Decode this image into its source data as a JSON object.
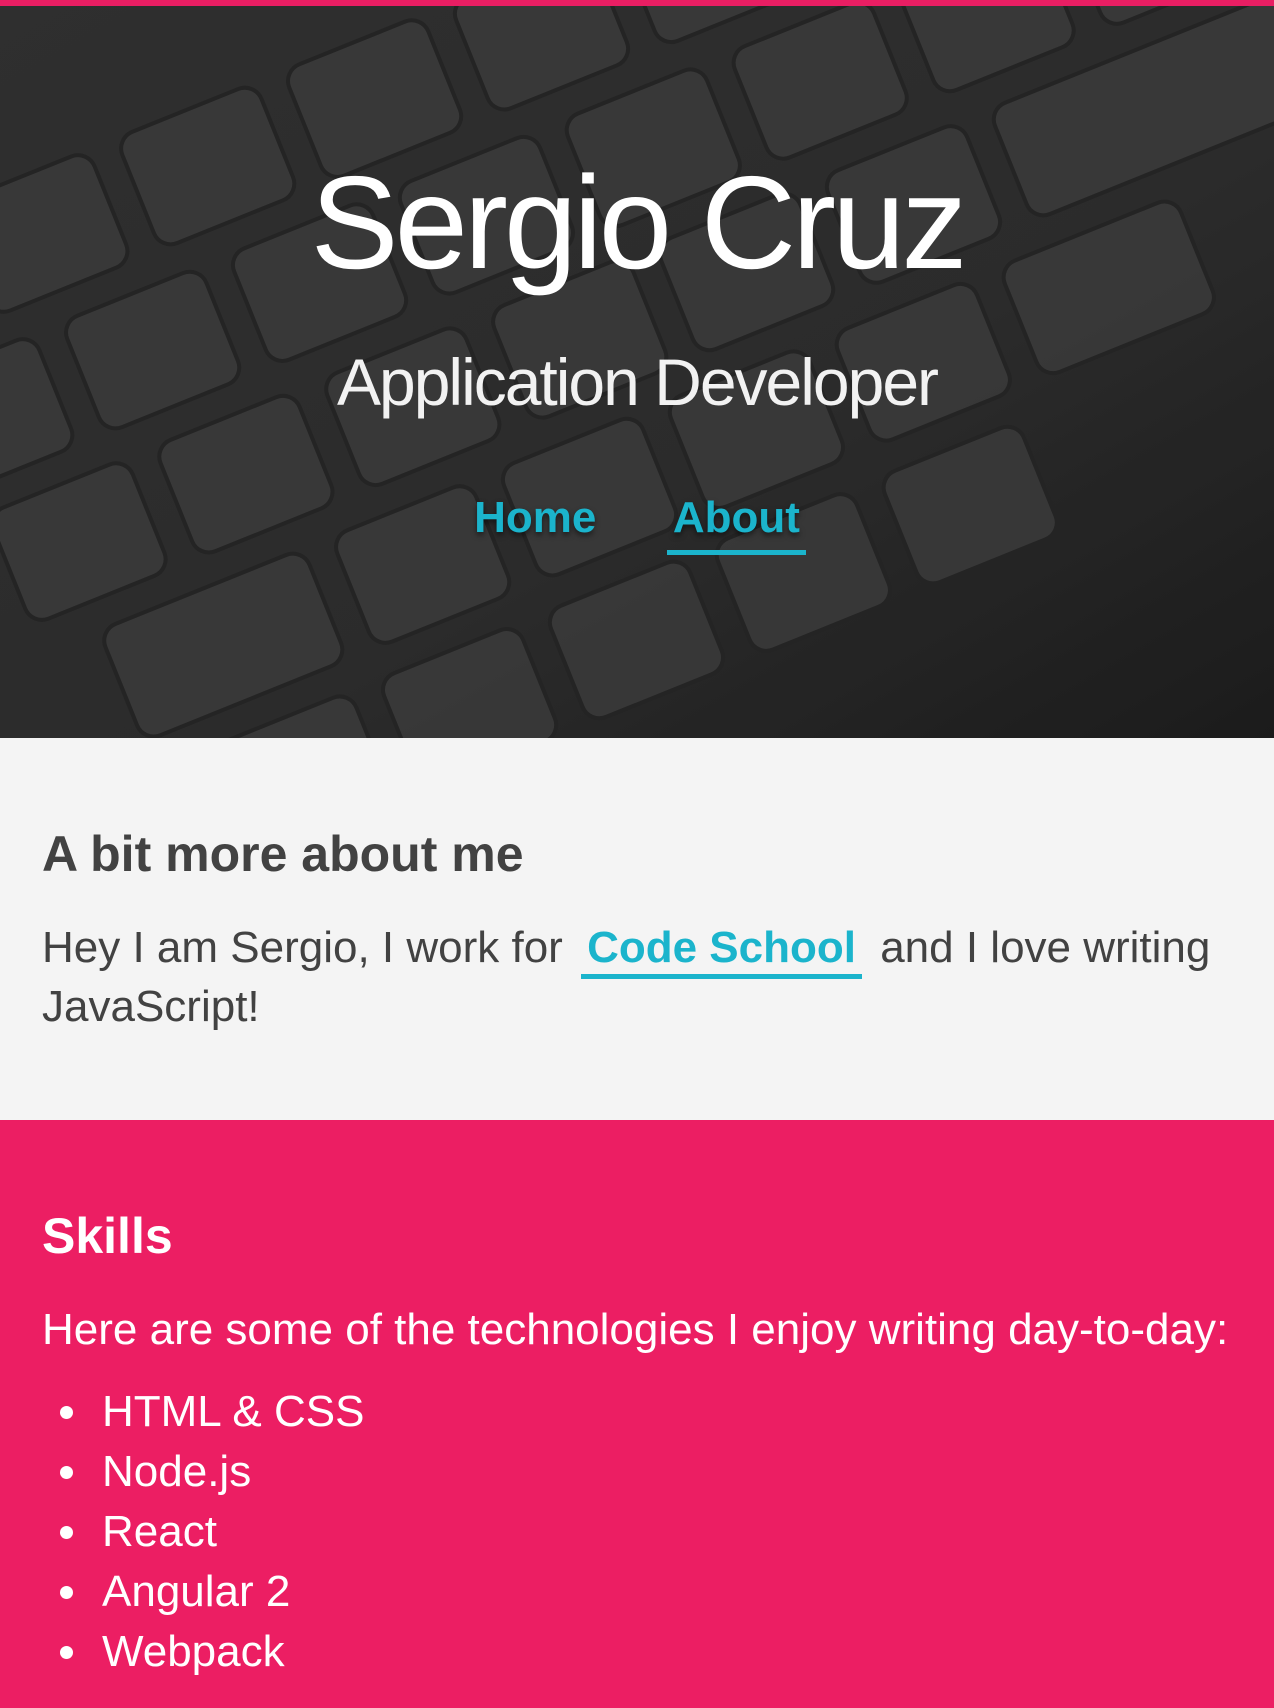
{
  "colors": {
    "accent": "#e91e63",
    "link": "#1bb4cc",
    "hero_overlay": "#3a3a3a",
    "about_bg": "#f4f4f4",
    "text_dark": "#424242",
    "skills_bg": "#ec1e63"
  },
  "hero": {
    "background_icon": "keyboard-photo",
    "title": "Sergio Cruz",
    "subtitle": "Application Developer",
    "nav": [
      {
        "label": "Home",
        "active": false
      },
      {
        "label": "About",
        "active": true
      }
    ]
  },
  "about": {
    "heading": "A bit more about me",
    "text_before": "Hey I am Sergio, I work for",
    "link_label": "Code School",
    "text_after": "and I love writing JavaScript!"
  },
  "skills": {
    "heading": "Skills",
    "intro": "Here are some of the technologies I enjoy writing day-to-day:",
    "items": [
      "HTML & CSS",
      "Node.js",
      "React",
      "Angular 2",
      "Webpack"
    ]
  }
}
